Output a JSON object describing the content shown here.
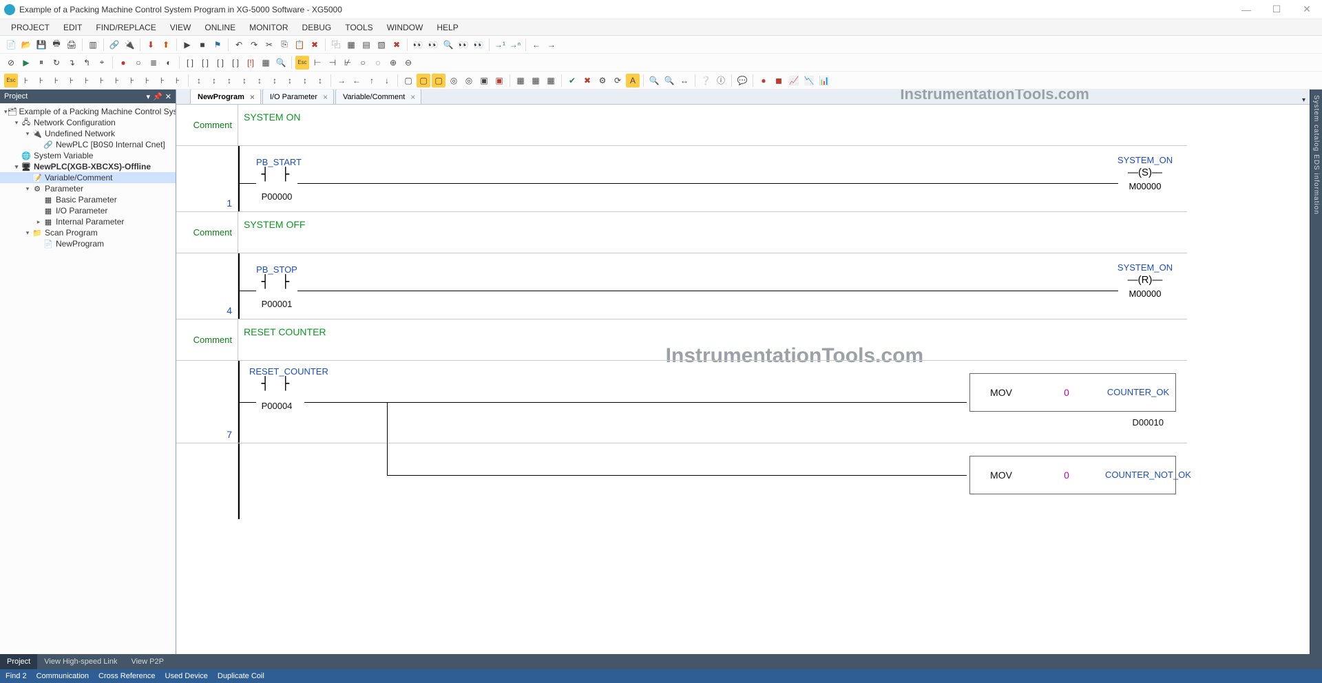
{
  "title": "Example of a Packing Machine Control System Program in XG-5000 Software - XG5000",
  "menu": [
    "PROJECT",
    "EDIT",
    "FIND/REPLACE",
    "VIEW",
    "ONLINE",
    "MONITOR",
    "DEBUG",
    "TOOLS",
    "WINDOW",
    "HELP"
  ],
  "panel": {
    "title": "Project"
  },
  "tree": {
    "root": "Example of a Packing Machine Control Sys...",
    "netcfg": "Network Configuration",
    "undef": "Undefined Network",
    "newplc_conn": "NewPLC [B0S0 Internal Cnet]",
    "sysvar": "System Variable",
    "plc": "NewPLC(XGB-XBCXS)-Offline",
    "varcomm": "Variable/Comment",
    "param": "Parameter",
    "basic": "Basic Parameter",
    "io": "I/O Parameter",
    "internal": "Internal Parameter",
    "scan": "Scan Program",
    "newprog": "NewProgram"
  },
  "leftTabs": {
    "t1": "Project",
    "t2": "View High-speed Link",
    "t3": "View P2P"
  },
  "editorTabs": {
    "t1": "NewProgram",
    "t2": "I/O Parameter",
    "t3": "Variable/Comment"
  },
  "watermark": "InstrumentationTools.com",
  "rightStrip": "System catalog  EDS information",
  "status": {
    "s1": "Find 2",
    "s2": "Communication",
    "s3": "Cross Reference",
    "s4": "Used Device",
    "s5": "Duplicate Coil"
  },
  "labels": {
    "comment": "Comment"
  },
  "rung1": {
    "comment": "SYSTEM ON",
    "num": "1",
    "contact_name": "PB_START",
    "contact_addr": "P00000",
    "coil_name": "SYSTEM_ON",
    "coil_sym": "S",
    "coil_addr": "M00000"
  },
  "rung2": {
    "comment": "SYSTEM OFF",
    "num": "4",
    "contact_name": "PB_STOP",
    "contact_addr": "P00001",
    "coil_name": "SYSTEM_ON",
    "coil_sym": "R",
    "coil_addr": "M00000"
  },
  "rung3": {
    "comment": "RESET COUNTER",
    "num": "7",
    "contact_name": "RESET_COUNTER",
    "contact_addr": "P00004",
    "box1": {
      "fn": "MOV",
      "arg": "0",
      "dest": "COUNTER_OK",
      "dest_addr": "D00010"
    },
    "box2": {
      "fn": "MOV",
      "arg": "0",
      "dest": "COUNTER_NOT_OK"
    }
  }
}
